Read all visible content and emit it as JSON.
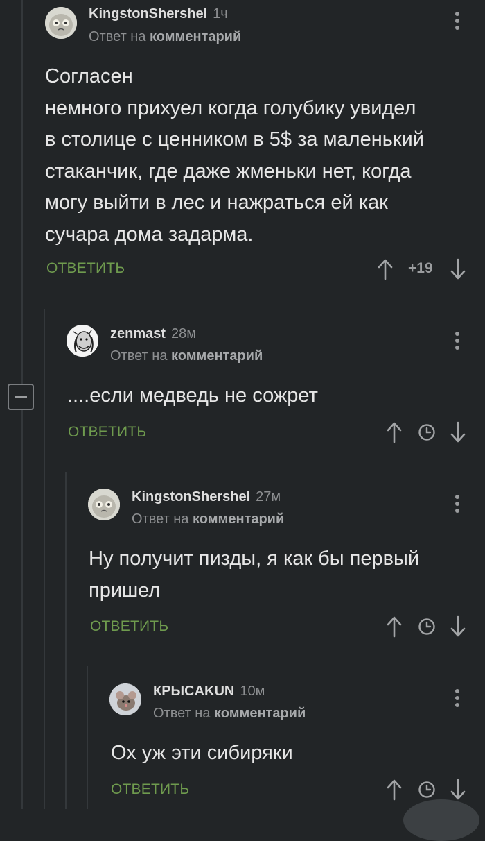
{
  "comments": [
    {
      "author": "KingstonShershel",
      "time": "1ч",
      "reply_prefix": "Ответ на",
      "reply_target": "комментарий",
      "text": "Согласен\nнемного прихуел когда голубику увидел\nв столице с ценником в 5$ за маленький\nстаканчик, где даже жменьки нет, когда\nмогу выйти в лес и нажраться ей как\nсучара дома задарма.",
      "reply_label": "ОТВЕТИТЬ",
      "score": "+19"
    },
    {
      "author": "zenmast",
      "time": "28м",
      "reply_prefix": "Ответ на",
      "reply_target": "комментарий",
      "text": "....если медведь не сожрет",
      "reply_label": "ОТВЕТИТЬ"
    },
    {
      "author": "KingstonShershel",
      "time": "27м",
      "reply_prefix": "Ответ на",
      "reply_target": "комментарий",
      "text": "Ну получит пизды, я как бы первый\nпришел",
      "reply_label": "ОТВЕТИТЬ"
    },
    {
      "author": "КРЫСAKUN",
      "time": "10м",
      "reply_prefix": "Ответ на",
      "reply_target": "комментарий",
      "text": "Ох уж эти сибиряки",
      "reply_label": "ОТВЕТИТЬ"
    }
  ],
  "icons": {
    "more": "kebab-menu-icon",
    "upvote": "arrow-up-icon",
    "downvote": "arrow-down-icon",
    "timer": "clock-icon",
    "collapse": "minus-icon"
  },
  "colors": {
    "background": "#222527",
    "reply_accent": "#6f9b4e",
    "muted": "#8d8f91"
  }
}
